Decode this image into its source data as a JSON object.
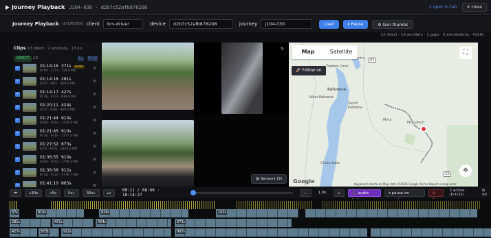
{
  "title": {
    "app": "Journey Playback",
    "sub": "J104-030 · d2b7c52afb878208",
    "open_tab": "↗ open in tab",
    "close": "✕ close"
  },
  "controls": {
    "heading": "Journey Playback",
    "count": "IS-199/200",
    "client_label": "client",
    "client_value": "brv-driver",
    "device_label": "device",
    "device_value": "d2b7c52afb878208",
    "journey_label": "journey",
    "journey_value": "J104-030",
    "load": "Load",
    "pause": "⏸ Pause",
    "gen": "⚙ Gen thumbs",
    "stats": "13 direct · 19 ancillary · 1 gaps · 0 annotations · 4126s"
  },
  "clips": {
    "title": "Clips",
    "summary": "13 direct · 2 ancillary · 13 on",
    "direct_tag": "DIRECT",
    "direct_count": "13",
    "all": "ALL",
    "none": "NONE",
    "items": [
      {
        "time": "01:14:16",
        "dur": "371s",
        "badge": "audio",
        "meta": "6209 · 371s · 728.8 MB"
      },
      {
        "time": "01:14:16",
        "dur": "281s",
        "badge": "",
        "meta": "b51f · 281s · 560.6 MB"
      },
      {
        "time": "01:14:17",
        "dur": "427s",
        "badge": "",
        "meta": "873b · 427s · 838.9 MB"
      },
      {
        "time": "01:20:11",
        "dur": "424s",
        "badge": "",
        "meta": "b51f · 424s · 868.5 MB"
      },
      {
        "time": "01:21:44",
        "dur": "910s",
        "badge": "",
        "meta": "6209 · 910s · 1778.9 MB"
      },
      {
        "time": "01:21:45",
        "dur": "910s",
        "badge": "",
        "meta": "873b · 910s · 1777.4 MB"
      },
      {
        "time": "01:27:52",
        "dur": "673s",
        "badge": "",
        "meta": "b51f · 673s · 1343.0 MB"
      },
      {
        "time": "01:36:55",
        "dur": "910s",
        "badge": "",
        "meta": "6209 · 910s · 1779.3 MB"
      },
      {
        "time": "01:36:56",
        "dur": "912s",
        "badge": "",
        "meta": "873b · 912s · 1776.7 MB"
      },
      {
        "time": "01:41:10",
        "dur": "863s",
        "badge": "",
        "meta": ""
      }
    ]
  },
  "video": {
    "rotate": "↻",
    "sensors": "▤ Sensors (9)"
  },
  "map": {
    "tab_map": "Map",
    "tab_sat": "Satellite",
    "follow": "🚀 Follow on",
    "kelowna": "Kelowna",
    "west_kelowna": "West Kelowna",
    "south_kelowna": "South Kelowna",
    "lake_country": "Lake Country",
    "traders_cove": "Traders Cove",
    "myra": "Myra",
    "mcculloch": "McCulloch",
    "chute_lake": "Chute Lake",
    "hwy97": "97",
    "hwy33": "33",
    "google": "Google",
    "attribution": "Keyboard shortcuts    Map data ©2026 Google    Terms    Report a map error"
  },
  "playback": {
    "skip_start": "⏮",
    "back30": "«30s",
    "back5": "«5s",
    "fwd5": "5s»",
    "fwd30": "30s»",
    "skip_end": "⏭",
    "time": "00:11 / 68:46 · 18:14:27",
    "minus": "−",
    "speed": "1.0x",
    "plus": "+",
    "audio_lock": "🎧 audio lock",
    "pause_annot": "⏸ pause on annot",
    "alerts": "⚠ 0",
    "active": "3 active (D·D·D)",
    "d0": "⊞ d0",
    "progress": 0.003
  },
  "timeline": {
    "rows": [
      {
        "labels": [
          "37s",
          "910s",
          "910s",
          "142s"
        ]
      },
      {
        "labels": [
          "281s",
          "451s",
          "424s",
          "673s",
          "863s"
        ]
      },
      {
        "labels": [
          "427s",
          "873b",
          "910s",
          "907s"
        ]
      }
    ]
  }
}
